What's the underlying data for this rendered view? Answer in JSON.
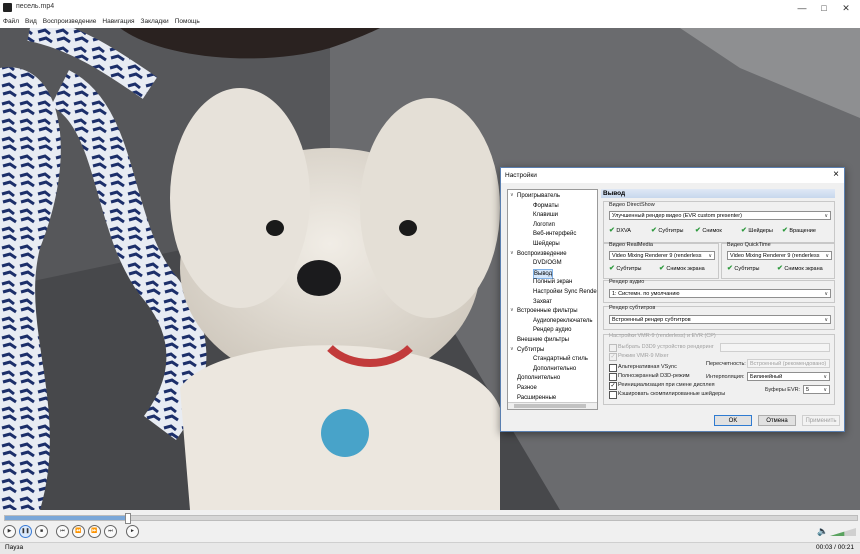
{
  "window": {
    "title": "песель.mp4"
  },
  "menu": [
    "Файл",
    "Вид",
    "Воспроизведение",
    "Навигация",
    "Закладки",
    "Помощь"
  ],
  "dialog": {
    "title": "Настройки",
    "tree": [
      {
        "label": "Проигрыватель",
        "level": 0,
        "expand": "v"
      },
      {
        "label": "Форматы",
        "level": 1
      },
      {
        "label": "Клавиши",
        "level": 1
      },
      {
        "label": "Логотип",
        "level": 1
      },
      {
        "label": "Веб-интерфейс",
        "level": 1
      },
      {
        "label": "Шейдеры",
        "level": 1
      },
      {
        "label": "Воспроизведение",
        "level": 0,
        "expand": "v"
      },
      {
        "label": "DVD/OGM",
        "level": 1
      },
      {
        "label": "Вывод",
        "level": 1,
        "selected": true
      },
      {
        "label": "Полный экран",
        "level": 1
      },
      {
        "label": "Настройки Sync Render",
        "level": 1
      },
      {
        "label": "Захват",
        "level": 1
      },
      {
        "label": "Встроенные фильтры",
        "level": 0,
        "expand": "v"
      },
      {
        "label": "Аудиопереключатель",
        "level": 1
      },
      {
        "label": "Рендер аудио",
        "level": 1
      },
      {
        "label": "Внешние фильтры",
        "level": 0
      },
      {
        "label": "Субтитры",
        "level": 0,
        "expand": "v"
      },
      {
        "label": "Стандартный стиль",
        "level": 1
      },
      {
        "label": "Дополнительно",
        "level": 1
      },
      {
        "label": "Дополнительно",
        "level": 0
      },
      {
        "label": "Разное",
        "level": 0
      },
      {
        "label": "Расширенные",
        "level": 0
      }
    ],
    "section_title": "Вывод",
    "ds": {
      "label": "Видео DirectShow",
      "value": "Улучшенный рендер видео (EVR custom presenter)",
      "checks": [
        "DXVA",
        "Субтитры",
        "Снимок",
        "Шейдеры",
        "Вращение"
      ]
    },
    "rm": {
      "label": "Видео RealMedia",
      "value": "Video Mixing Renderer 9 (renderless",
      "checks": [
        "Субтитры",
        "Снимок экрана"
      ]
    },
    "qt": {
      "label": "Видео QuickTime",
      "value": "Video Mixing Renderer 9 (renderless",
      "checks": [
        "Субтитры",
        "Снимок экрана"
      ]
    },
    "audio": {
      "label": "Рендер аудио",
      "value": "1: Системн. по умолчанию"
    },
    "subs": {
      "label": "Рендер субтитров",
      "value": "Встроенный рендер субтитров"
    },
    "vmr": {
      "label": "Настройки VMR-9 (renderless) и EVR (CP)",
      "d3d_device": "Выбрать D3D9 устройство рендеринг",
      "mixer": "Режим VMR-9 Mixer",
      "alt_vsync": "Альтернативная VSync",
      "fullscreen_d3d": "Полноэкранный D3D-режим",
      "reinit": "Реинициализация при смене дисплея",
      "cache_shaders": "Кэшировать скомпилированные шейдеры",
      "resize_label": "Пересчетность:",
      "resize_value": "Встроенный (рекомендовано)",
      "interp_label": "Интерполяция:",
      "interp_value": "Билинейный",
      "buffers_label": "Буферы EVR:",
      "buffers_value": "5"
    },
    "buttons": {
      "ok": "OK",
      "cancel": "Отмена",
      "apply": "Применить"
    }
  },
  "player": {
    "status": "Пауза",
    "time": "00:03 / 00:21",
    "progress": 0.143,
    "volume": 0.55
  },
  "colors": {
    "accent": "#3a7bd5",
    "check": "#2e9a3e",
    "section": "#c7d7ed"
  }
}
